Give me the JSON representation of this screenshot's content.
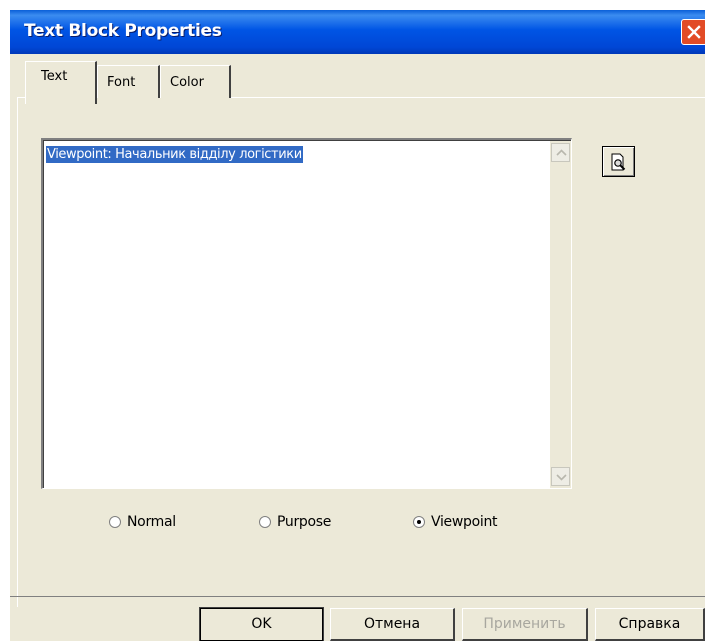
{
  "window": {
    "title": "Text Block Properties"
  },
  "tabs": [
    {
      "label": "Text",
      "active": true
    },
    {
      "label": "Font",
      "active": false
    },
    {
      "label": "Color",
      "active": false
    }
  ],
  "editor": {
    "value": "Viewpoint: Начальник відділу логістики"
  },
  "radio_group": {
    "options": [
      {
        "label": "Normal",
        "checked": false
      },
      {
        "label": "Purpose",
        "checked": false
      },
      {
        "label": "Viewpoint",
        "checked": true
      }
    ]
  },
  "buttons": {
    "ok": "OK",
    "cancel": "Отмена",
    "apply": "Применить",
    "help": "Справка"
  },
  "colors": {
    "titlebar": "#0055e5",
    "close": "#e24b26",
    "face": "#ece9d8",
    "selection": "#316ac5"
  },
  "icons": {
    "close": "close-icon",
    "preview": "preview-magnifier-icon",
    "scroll_up": "arrow-up-icon",
    "scroll_down": "arrow-down-icon"
  }
}
